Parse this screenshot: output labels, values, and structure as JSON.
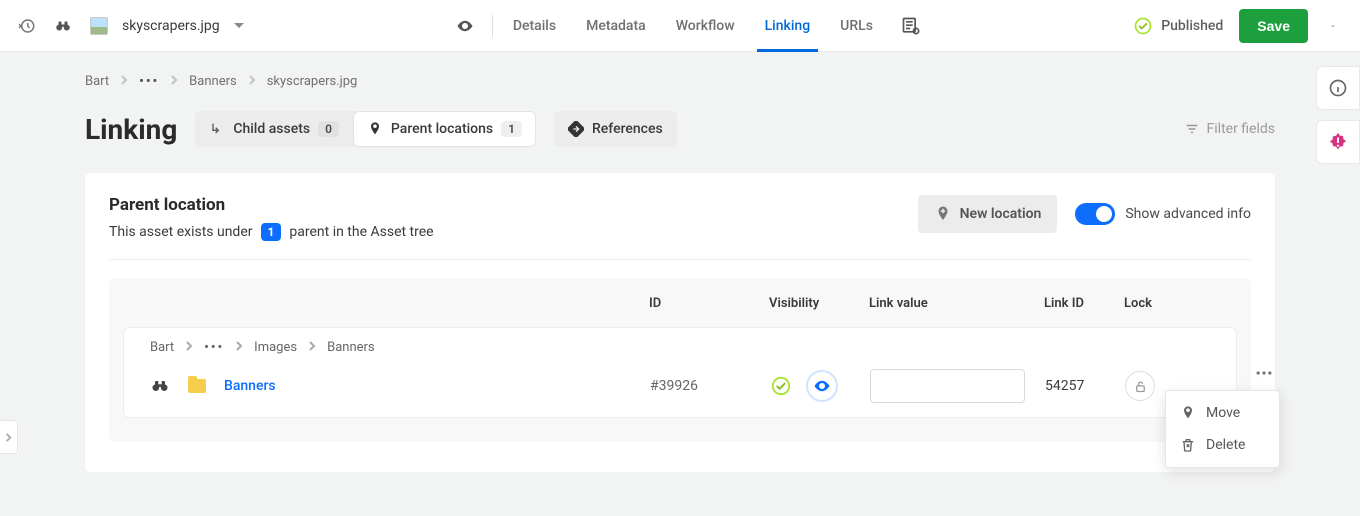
{
  "topbar": {
    "filename": "skyscrapers.jpg",
    "tabs": {
      "details": "Details",
      "metadata": "Metadata",
      "workflow": "Workflow",
      "linking": "Linking",
      "urls": "URLs"
    },
    "status_label": "Published",
    "save_label": "Save"
  },
  "breadcrumbs": {
    "root": "Bart",
    "mid": "Banners",
    "leaf": "skyscrapers.jpg"
  },
  "page": {
    "title": "Linking",
    "filter_label": "Filter fields"
  },
  "pills": {
    "child_label": "Child assets",
    "child_count": "0",
    "parent_label": "Parent locations",
    "parent_count": "1",
    "references_label": "References"
  },
  "panel": {
    "title": "Parent location",
    "sub_pre": "This asset exists under",
    "sub_count": "1",
    "sub_post": "parent in the Asset tree",
    "new_location_label": "New location",
    "toggle_label": "Show advanced info"
  },
  "table": {
    "headers": {
      "id": "ID",
      "visibility": "Visibility",
      "link_value": "Link value",
      "link_id": "Link ID",
      "lock": "Lock"
    },
    "row": {
      "crumbs": {
        "a": "Bart",
        "b": "Images",
        "c": "Banners"
      },
      "name": "Banners",
      "id": "#39926",
      "link_value": "",
      "link_id": "54257"
    }
  },
  "dropdown": {
    "move": "Move",
    "delete": "Delete"
  }
}
